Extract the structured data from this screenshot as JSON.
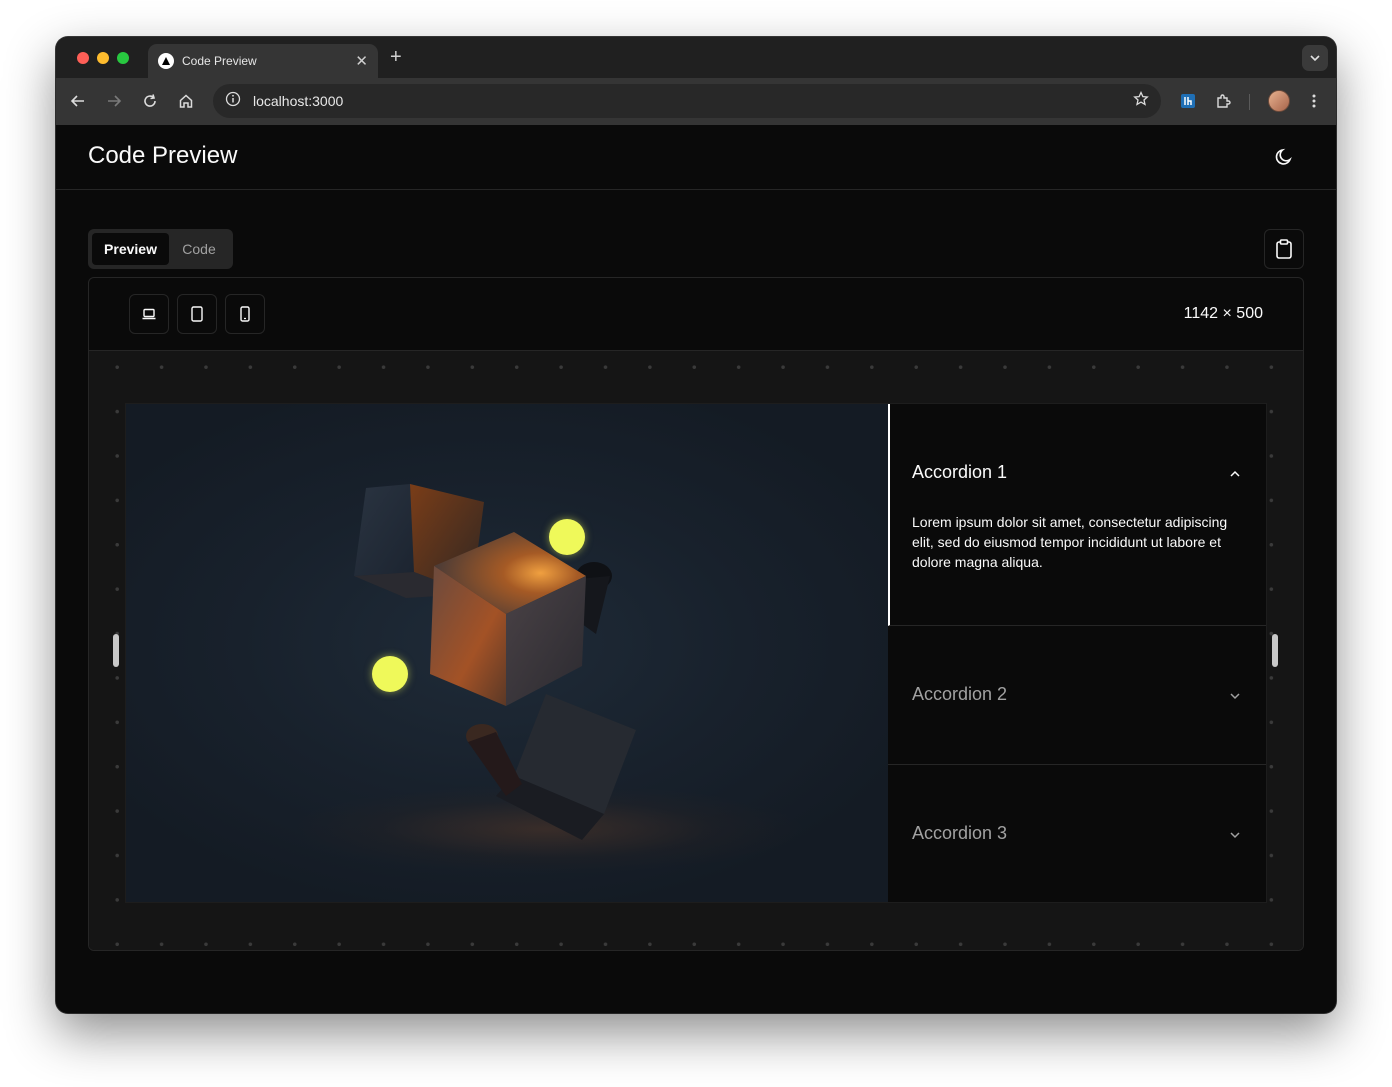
{
  "browser": {
    "tab_title": "Code Preview",
    "url": "localhost:3000"
  },
  "header": {
    "title": "Code Preview"
  },
  "tabs": {
    "preview_label": "Preview",
    "code_label": "Code"
  },
  "viewport": {
    "size_readout": "1142 × 500"
  },
  "accordion": {
    "items": [
      {
        "title": "Accordion 1",
        "body": "Lorem ipsum dolor sit amet, consectetur adipiscing elit, sed do eiusmod tempor incididunt ut labore et dolore magna aliqua.",
        "expanded": true
      },
      {
        "title": "Accordion 2",
        "expanded": false
      },
      {
        "title": "Accordion 3",
        "expanded": false
      }
    ]
  },
  "colors": {
    "accent_orb": "#eff95a",
    "background": "#0a0a0a",
    "border": "#262626"
  }
}
